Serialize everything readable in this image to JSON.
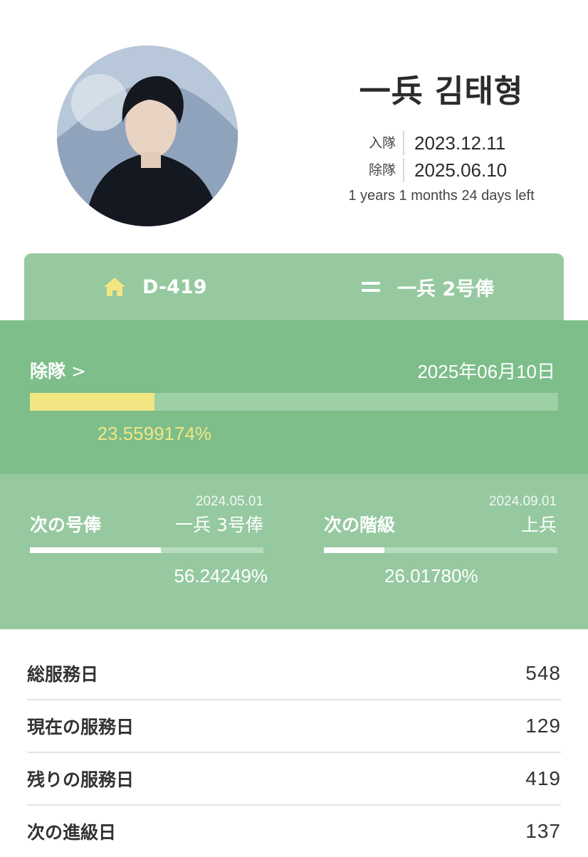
{
  "profile": {
    "name": "一兵 김태형",
    "enlist_label": "入隊",
    "enlist_date": "2023.12.11",
    "discharge_label": "除隊",
    "discharge_date": "2025.06.10",
    "time_left": "1 years 1 months 24 days left"
  },
  "tabs": {
    "dday": "D-419",
    "rank_pay": "一兵 2号俸",
    "home_icon": "home-icon",
    "equals_icon": "equals-icon"
  },
  "discharge_progress": {
    "label": "除隊",
    "chevron": ">",
    "date": "2025年06月10日",
    "percent_text": "23.5599174%",
    "fraction": 0.235599174
  },
  "next_pay": {
    "label": "次の号俸",
    "date": "2024.05.01",
    "value": "一兵 3号俸",
    "percent_text": "56.24249%",
    "fraction": 0.5624249
  },
  "next_rank": {
    "label": "次の階級",
    "date": "2024.09.01",
    "value": "上兵",
    "percent_text": "26.01780%",
    "fraction": 0.260178
  },
  "stats": [
    {
      "label": "総服務日",
      "value": "548"
    },
    {
      "label": "現在の服務日",
      "value": "129"
    },
    {
      "label": "残りの服務日",
      "value": "419"
    },
    {
      "label": "次の進級日",
      "value": "137"
    }
  ],
  "colors": {
    "header_green": "#96c9a0",
    "progress_green": "#7dbe8a",
    "accent_yellow": "#f2e683"
  }
}
